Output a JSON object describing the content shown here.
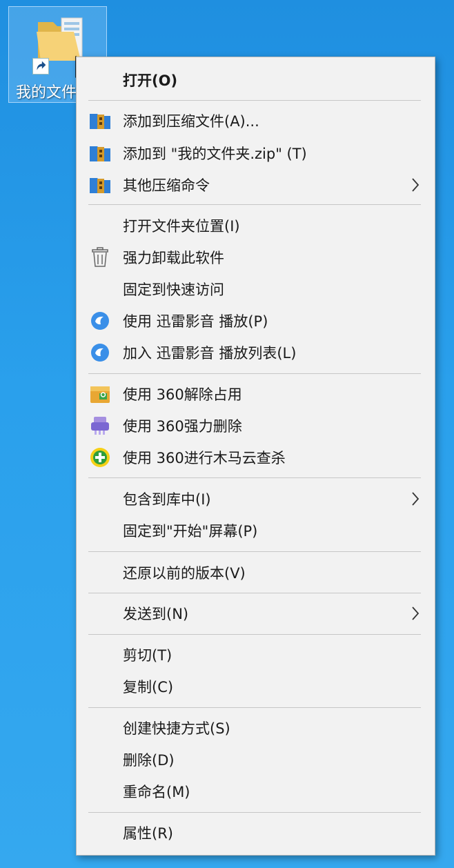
{
  "desktop": {
    "icon_label": "我的文件夹"
  },
  "menu": {
    "items": [
      {
        "label": "打开(O)"
      },
      {
        "label": "添加到压缩文件(A)..."
      },
      {
        "label": "添加到 \"我的文件夹.zip\" (T)"
      },
      {
        "label": "其他压缩命令"
      },
      {
        "label": "打开文件夹位置(I)"
      },
      {
        "label": "强力卸载此软件"
      },
      {
        "label": "固定到快速访问"
      },
      {
        "label": "使用 迅雷影音 播放(P)"
      },
      {
        "label": "加入 迅雷影音 播放列表(L)"
      },
      {
        "label": "使用 360解除占用"
      },
      {
        "label": "使用 360强力删除"
      },
      {
        "label": "使用 360进行木马云查杀"
      },
      {
        "label": "包含到库中(I)"
      },
      {
        "label": "固定到\"开始\"屏幕(P)"
      },
      {
        "label": "还原以前的版本(V)"
      },
      {
        "label": "发送到(N)"
      },
      {
        "label": "剪切(T)"
      },
      {
        "label": "复制(C)"
      },
      {
        "label": "创建快捷方式(S)"
      },
      {
        "label": "删除(D)"
      },
      {
        "label": "重命名(M)"
      },
      {
        "label": "属性(R)"
      }
    ]
  },
  "colors": {
    "desktop_background": "#2aa0ec",
    "menu_background": "#f2f2f2",
    "separator": "#c6c6c6"
  }
}
